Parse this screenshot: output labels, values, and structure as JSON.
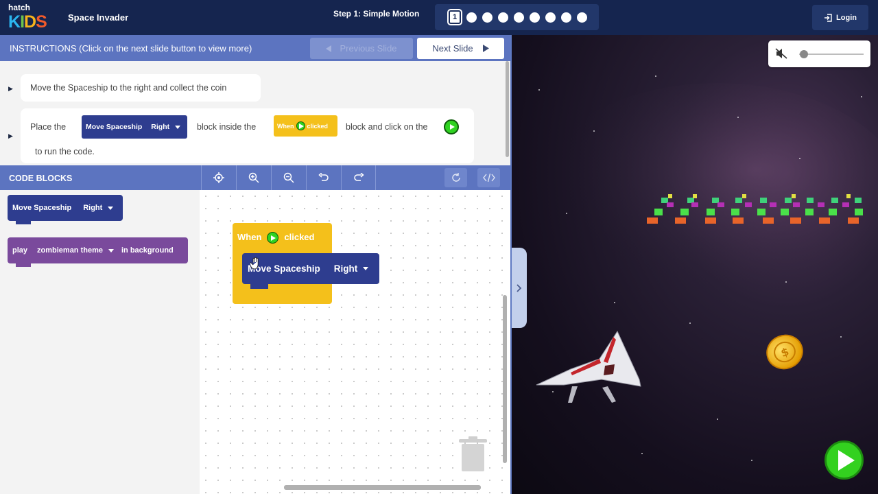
{
  "header": {
    "logo_top": "hatch",
    "logo_letters": [
      "K",
      "I",
      "D",
      "S"
    ],
    "app_title": "Space Invader",
    "step_title": "Step 1: Simple Motion",
    "current_step": "1",
    "login_label": "Login"
  },
  "instructions": {
    "title": "INSTRUCTIONS (Click on the next slide button to view more)",
    "prev_label": "Previous Slide",
    "next_label": "Next Slide",
    "item1": "Move the Spaceship to the right and collect the coin",
    "item2_part1": "Place the",
    "item2_part2": "block inside the",
    "item2_part3": "block and click on the",
    "item2_part4": "to run the code.",
    "inline_move_label": "Move Spaceship",
    "inline_move_dir": "Right",
    "inline_when": "When",
    "inline_clicked": "clicked"
  },
  "code_blocks": {
    "title": "CODE BLOCKS",
    "palette": {
      "move_label": "Move Spaceship",
      "move_dir": "Right",
      "play_label": "play",
      "play_sound": "zombieman theme",
      "play_suffix": "in background"
    },
    "workspace": {
      "when_label": "When",
      "clicked_label": "clicked",
      "move_label": "Move Spaceship",
      "move_dir": "Right"
    }
  },
  "colors": {
    "header_bg": "#15254f",
    "bar_bg": "#5c74c0",
    "motion_block": "#2e3d8f",
    "event_block": "#f4c01b",
    "sound_block": "#7a4a9c",
    "run_green": "#33d11f"
  }
}
